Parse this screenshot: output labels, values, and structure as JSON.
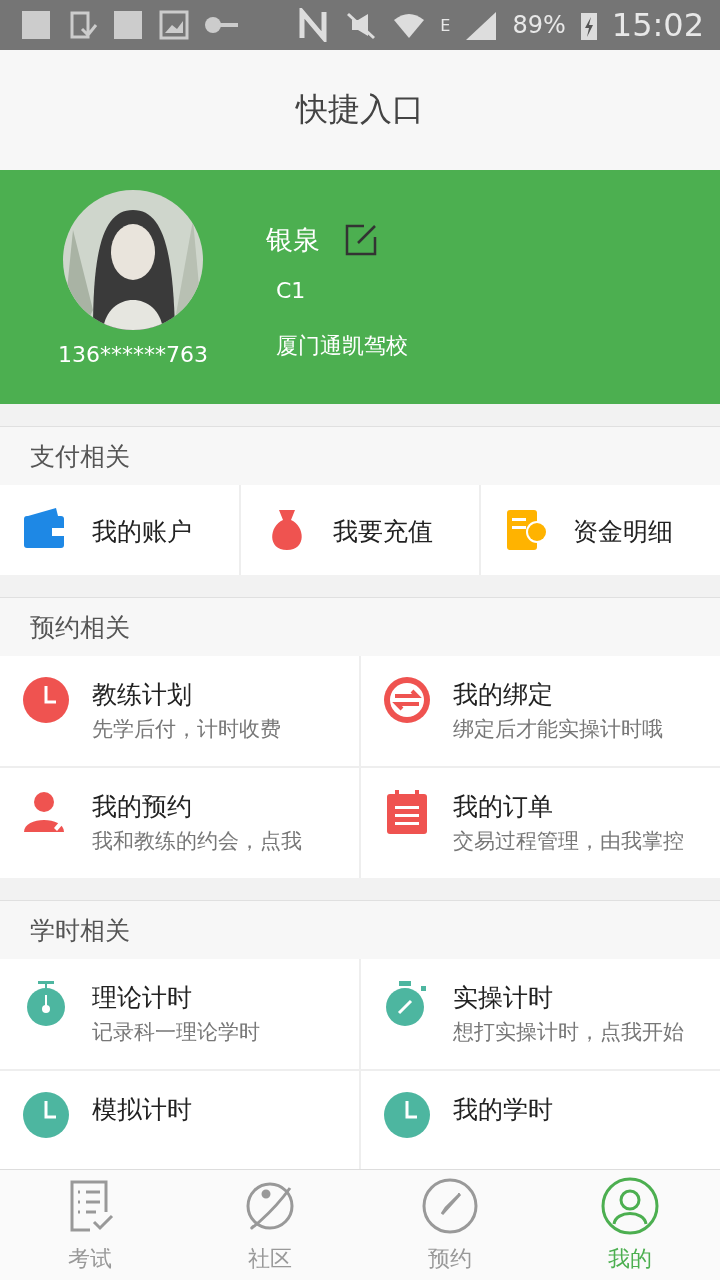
{
  "status_bar": {
    "network": "E",
    "battery": "89%",
    "time": "15:02"
  },
  "header": {
    "title": "快捷入口"
  },
  "profile": {
    "name": "银泉",
    "license": "C1",
    "phone": "136******763",
    "school": "厦门通凯驾校"
  },
  "sections": [
    {
      "title": "支付相关",
      "items": [
        {
          "title": "我的账户"
        },
        {
          "title": "我要充值"
        },
        {
          "title": "资金明细"
        }
      ]
    },
    {
      "title": "预约相关",
      "items": [
        {
          "title": "教练计划",
          "subtitle": "先学后付，计时收费"
        },
        {
          "title": "我的绑定",
          "subtitle": "绑定后才能实操计时哦"
        },
        {
          "title": "我的预约",
          "subtitle": "我和教练的约会，点我"
        },
        {
          "title": "我的订单",
          "subtitle": "交易过程管理，由我掌控"
        }
      ]
    },
    {
      "title": "学时相关",
      "items": [
        {
          "title": "理论计时",
          "subtitle": "记录科一理论学时"
        },
        {
          "title": "实操计时",
          "subtitle": "想打实操计时，点我开始"
        },
        {
          "title": "模拟计时"
        },
        {
          "title": "我的学时"
        }
      ]
    }
  ],
  "tabs": [
    {
      "label": "考试",
      "selected": false
    },
    {
      "label": "社区",
      "selected": false
    },
    {
      "label": "预约",
      "selected": false
    },
    {
      "label": "我的",
      "selected": true
    }
  ]
}
